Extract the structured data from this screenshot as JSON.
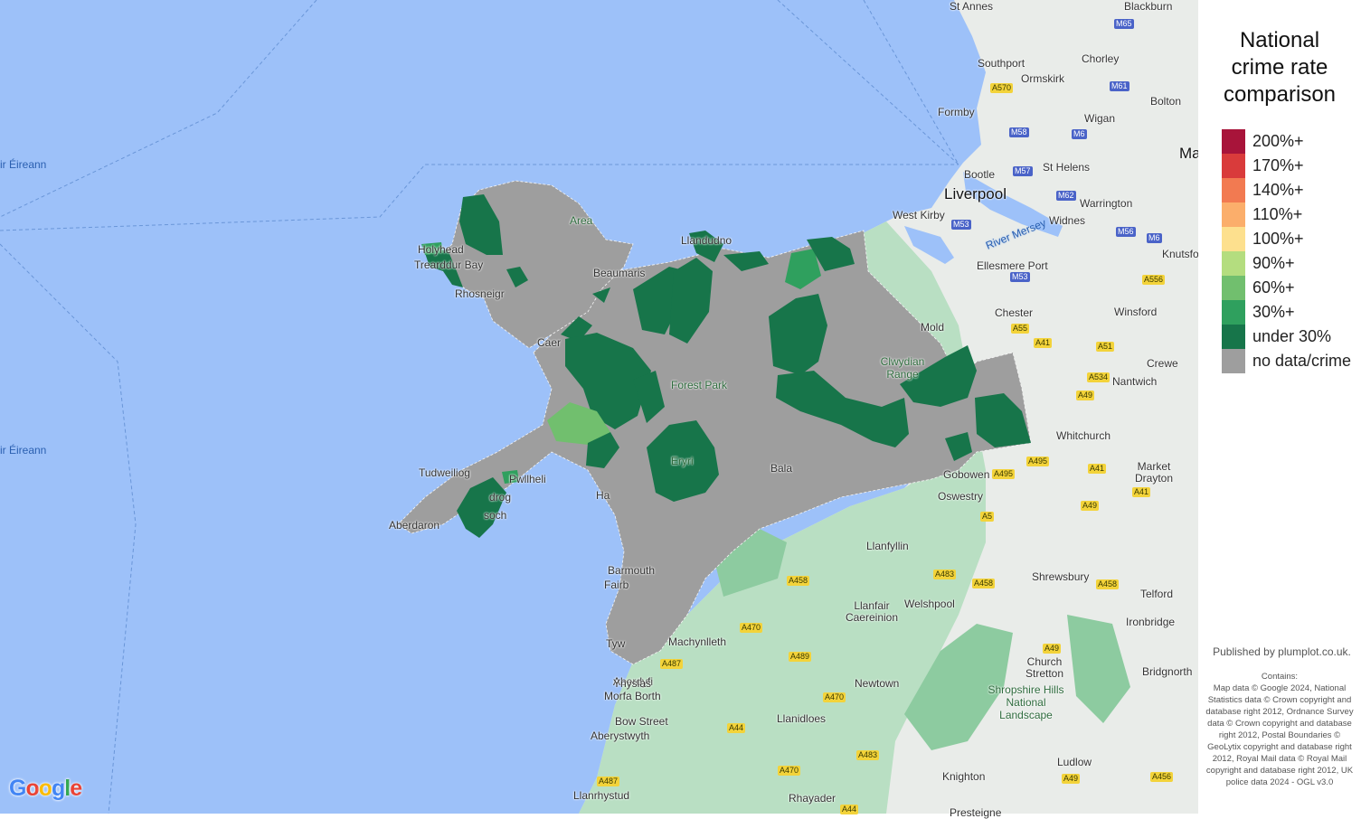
{
  "legend": {
    "title_lines": [
      "National",
      "crime rate",
      "comparison"
    ],
    "items": [
      {
        "label": "200%+",
        "color": "#a8143a"
      },
      {
        "label": "170%+",
        "color": "#d93b3b"
      },
      {
        "label": "140%+",
        "color": "#f27a51"
      },
      {
        "label": "110%+",
        "color": "#fbae6b"
      },
      {
        "label": "100%+",
        "color": "#fde08e"
      },
      {
        "label": "90%+",
        "color": "#b4dd7f"
      },
      {
        "label": "60%+",
        "color": "#71bf6e"
      },
      {
        "label": "30%+",
        "color": "#2fa05e"
      },
      {
        "label": "under 30%",
        "color": "#17754a"
      },
      {
        "label": "no data/crime",
        "color": "#9e9e9e"
      }
    ]
  },
  "attribution": {
    "published": "Published by plumplot.co.uk.",
    "contains": "Contains:\nMap data © Google 2024, National Statistics data © Crown copyright and database right 2012, Ordnance Survey data © Crown copyright and database right 2012, Postal Boundaries © GeoLytix copyright and database right 2012, Royal Mail data © Royal Mail copyright and database right 2012, UK police data 2024 - OGL v3.0"
  },
  "google_logo": [
    "G",
    "o",
    "o",
    "g",
    "l",
    "e"
  ],
  "google_colors": [
    "#4285f4",
    "#ea4335",
    "#fbbc05",
    "#4285f4",
    "#34a853",
    "#ea4335"
  ],
  "places": {
    "st_annes": "St Annes",
    "blackburn": "Blackburn",
    "southport": "Southport",
    "chorley": "Chorley",
    "ormskirk": "Ormskirk",
    "bolton": "Bolton",
    "formby": "Formby",
    "wigan": "Wigan",
    "bootle": "Bootle",
    "st_helens": "St Helens",
    "liverpool": "Liverpool",
    "warrington": "Warrington",
    "west_kirby": "West Kirby",
    "widnes": "Widnes",
    "river_mersey": "River Mersey",
    "ellesmere_port": "Ellesmere Port",
    "knutsford": "Knutsfo",
    "chester": "Chester",
    "winsford": "Winsford",
    "mold": "Mold",
    "crewe": "Crewe",
    "nantwich": "Nantwich",
    "whitchurch": "Whitchurch",
    "market_drayton": "Market Drayton",
    "gobowen": "Gobowen",
    "oswestry": "Oswestry",
    "llanfyllin": "Llanfyllin",
    "shrewsbury": "Shrewsbury",
    "telford": "Telford",
    "ironbridge": "Ironbridge",
    "llanfair_caereinion": "Llanfair Caereinion",
    "welshpool": "Welshpool",
    "machynlleth": "Machynlleth",
    "newtown": "Newtown",
    "church_stretton": "Church Stretton",
    "bridgnorth": "Bridgnorth",
    "shropshire_hills": "Shropshire Hills National Landscape",
    "llanidloes": "Llanidloes",
    "aberdyfi": "Aberdyfi",
    "ynyslas": "Ynyslas",
    "morfa_borth": "Morfa Borth",
    "bow_street": "Bow Street",
    "aberystwyth": "Aberystwyth",
    "ludlow": "Ludlow",
    "knighton": "Knighton",
    "rhayader": "Rhayader",
    "llanrhystud": "Llanrhystud",
    "presteigne": "Presteigne",
    "barmouth": "Barmouth",
    "fairbourne": "Fairb",
    "harlech": "Ha",
    "tywyn": "Tyw",
    "bala": "Bala",
    "tudweiliog": "Tudweiliog",
    "abersoch": "soch",
    "aberdaron": "Aberdaron",
    "pwllheli": "Pwllheli",
    "llanbedrog": "drog",
    "caernarfon": "Caer",
    "bangor": "Beaumaris",
    "holyhead": "Holyhead",
    "trearddur": "Trearddur Bay",
    "rhosneigr": "Rhosneigr",
    "llandudno": "Llandudno",
    "sea_irish_1": "ir Éireann",
    "sea_irish_2": "ir Éireann",
    "aonb": "Area",
    "eryri": "Eryri",
    "clwydian": "Clwydian Range",
    "forest": "Forest Park",
    "manchester": "Ma"
  },
  "roads": {
    "m65": "M65",
    "m61": "M61",
    "a570": "A570",
    "m58": "M58",
    "m6a": "M6",
    "m57": "M57",
    "m62": "M62",
    "m53a": "M53",
    "m53b": "M53",
    "m56": "M56",
    "m6b": "M6",
    "a556": "A556",
    "a55": "A55",
    "a41a": "A41",
    "a51": "A51",
    "a534": "A534",
    "a49a": "A49",
    "a495a": "A495",
    "a495b": "A495",
    "a41b": "A41",
    "a41c": "A41",
    "a5": "A5",
    "a49b": "A49",
    "a483a": "A483",
    "a458a": "A458",
    "a458b": "A458",
    "a458c": "A458",
    "a470a": "A470",
    "a489": "A489",
    "a487a": "A487",
    "a470b": "A470",
    "a44a": "A44",
    "a483b": "A483",
    "a470c": "A470",
    "a49c": "A49",
    "a4": "A49",
    "a456": "A456",
    "a487b": "A487",
    "a44b": "A44"
  },
  "regions": [
    {
      "id": "anglesey-nw",
      "color": "#17754a"
    },
    {
      "id": "holyhead",
      "color": "#17754a"
    },
    {
      "id": "holyhead-30",
      "color": "#2fa05e"
    },
    {
      "id": "anglesey-c",
      "color": "#17754a"
    },
    {
      "id": "menai",
      "color": "#17754a"
    },
    {
      "id": "caernarfon",
      "color": "#17754a"
    },
    {
      "id": "conwy-1",
      "color": "#17754a"
    },
    {
      "id": "conwy-2",
      "color": "#17754a"
    },
    {
      "id": "llandudno",
      "color": "#17754a"
    },
    {
      "id": "colwyn",
      "color": "#17754a"
    },
    {
      "id": "rhyl-30",
      "color": "#2fa05e"
    },
    {
      "id": "prestatyn",
      "color": "#17754a"
    },
    {
      "id": "denbigh",
      "color": "#17754a"
    },
    {
      "id": "ruthin-corwen",
      "color": "#17754a"
    },
    {
      "id": "wrexham",
      "color": "#17754a"
    },
    {
      "id": "wrexham-s",
      "color": "#17754a"
    },
    {
      "id": "chirk",
      "color": "#17754a"
    },
    {
      "id": "snowdonia",
      "color": "#17754a"
    },
    {
      "id": "llanberis",
      "color": "#17754a"
    },
    {
      "id": "nantlle-60",
      "color": "#71bf6e"
    },
    {
      "id": "porthmadog",
      "color": "#17754a"
    },
    {
      "id": "blaenau",
      "color": "#17754a"
    },
    {
      "id": "llyn-south",
      "color": "#17754a"
    },
    {
      "id": "pwllheli-30",
      "color": "#2fa05e"
    }
  ]
}
